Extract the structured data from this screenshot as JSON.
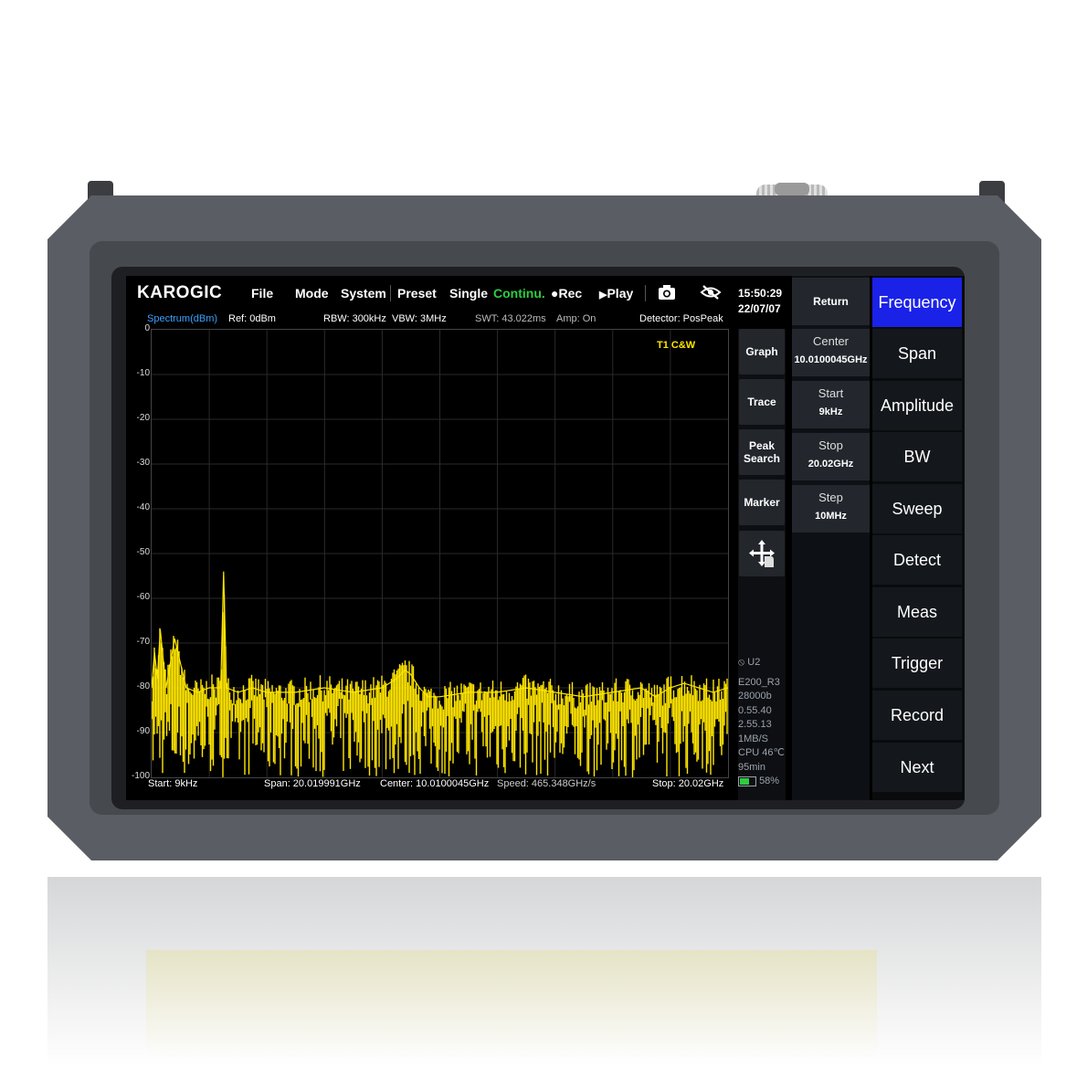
{
  "brand": "KAROGIC",
  "menu": {
    "file": "File",
    "mode": "Mode",
    "system": "System",
    "preset": "Preset",
    "single": "Single",
    "continu": "Continu.",
    "rec": "Rec",
    "play": "Play"
  },
  "info": {
    "spectrum": "Spectrum(dBm)",
    "ref": "Ref: 0dBm",
    "rbw": "RBW: 300kHz",
    "vbw": "VBW: 3MHz",
    "swt": "SWT: 43.022ms",
    "amp": "Amp: On",
    "detector": "Detector: PosPeak"
  },
  "status": {
    "time": "15:50:29",
    "date": "22/07/07"
  },
  "graph_buttons": [
    "Graph",
    "Trace",
    "Peak\nSearch",
    "Marker"
  ],
  "freq_panel": {
    "return_label": "Return",
    "fields": [
      {
        "label": "Center",
        "value": "10.0100045GHz"
      },
      {
        "label": "Start",
        "value": "9kHz"
      },
      {
        "label": "Stop",
        "value": "20.02GHz"
      },
      {
        "label": "Step",
        "value": "10MHz"
      }
    ]
  },
  "main_menu": [
    "Frequency",
    "Span",
    "Amplitude",
    "BW",
    "Sweep",
    "Detect",
    "Meas",
    "Trigger",
    "Record",
    "Next"
  ],
  "system_info": {
    "u2": "U2",
    "model": "E200_R3",
    "line2": "28000b",
    "line3": "0.55.40",
    "line4": "2.55.13",
    "line5": "1MB/S",
    "cpu": "CPU 46℃",
    "time_left": "95min",
    "battery": "58%"
  },
  "bottom": {
    "start": "Start: 9kHz",
    "span": "Span: 20.019991GHz",
    "center": "Center: 10.0100045GHz",
    "speed": "Speed: 465.348GHz/s",
    "stop": "Stop: 20.02GHz"
  },
  "marker_label": "T1  C&W",
  "colors": {
    "trace": "#ffe600",
    "active_menu": "#1a22e8",
    "continuous": "#2ecc40",
    "spectrum_label": "#3aa0ff"
  },
  "chart_data": {
    "type": "line",
    "xlabel": "",
    "ylabel": "",
    "xlim": [
      9e-06,
      20.02
    ],
    "ylim": [
      -100,
      0
    ],
    "yticks": [
      "0",
      "-10",
      "-20",
      "-30",
      "-40",
      "-50",
      "-60",
      "-70",
      "-80",
      "-90",
      "-100"
    ],
    "grid": true,
    "series": [
      {
        "name": "T1",
        "x": [
          0.0,
          0.1,
          0.2,
          0.3,
          0.5,
          0.8,
          1.2,
          1.6,
          2.0,
          2.4,
          2.5,
          2.6,
          3.0,
          3.5,
          4.0,
          5.0,
          6.0,
          7.0,
          8.0,
          8.5,
          8.8,
          9.0,
          9.3,
          9.6,
          10.0,
          11.0,
          12.0,
          13.0,
          14.0,
          15.0,
          16.0,
          17.0,
          17.5,
          18.0,
          18.5,
          19.0,
          19.5,
          20.02
        ],
        "y": [
          -80,
          -72,
          -78,
          -67,
          -80,
          -69,
          -80,
          -81,
          -80,
          -80,
          -54,
          -80,
          -81,
          -80,
          -81,
          -81,
          -80,
          -81,
          -80,
          -78,
          -76,
          -77,
          -80,
          -82,
          -82,
          -81,
          -81,
          -80,
          -81,
          -82,
          -81,
          -80,
          -82,
          -80,
          -79,
          -80,
          -81,
          -80
        ]
      }
    ]
  }
}
